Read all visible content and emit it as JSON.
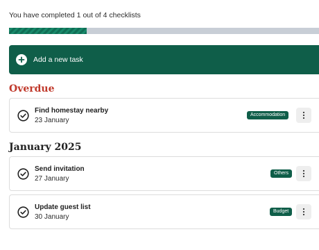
{
  "progress": {
    "text": "You have completed 1 out of 4 checklists",
    "completed": 1,
    "total": 4
  },
  "add_task": {
    "label": "Add a new task",
    "icon": "plus-icon"
  },
  "sections": {
    "overdue": {
      "title": "Overdue",
      "title_color": "#c0392b",
      "tasks": [
        {
          "title": "Find homestay nearby",
          "date": "23 January",
          "tag": "Accommodation"
        }
      ]
    },
    "january": {
      "title": "January 2025",
      "tasks": [
        {
          "title": "Send invitation",
          "date": "27 January",
          "tag": "Others"
        },
        {
          "title": "Update guest list",
          "date": "30 January",
          "tag": "Budget"
        }
      ]
    }
  },
  "icons": {
    "task_status": "check-circle-icon",
    "task_menu": "more-vertical-icon"
  },
  "colors": {
    "primary": "#0f5e49",
    "progress_track": "#c8ced6",
    "tag_background": "#0f5e49",
    "overdue": "#c0392b"
  }
}
